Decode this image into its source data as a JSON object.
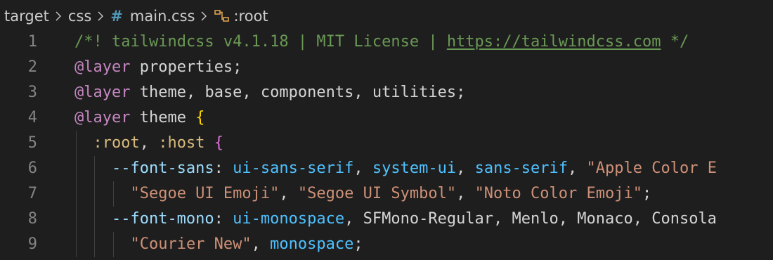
{
  "breadcrumb": {
    "items": [
      "target",
      "css",
      "main.css",
      ":root"
    ],
    "file_icon": "hash-icon",
    "symbol_icon": "symbol-icon"
  },
  "colors": {
    "background": "#1e1e1e",
    "line_number": "#858585",
    "comment": "#6a9955",
    "at_rule": "#c586c0",
    "selector": "#d7ba7d",
    "property": "#9cdcfe",
    "keyword": "#4fc1ff",
    "string": "#ce9178",
    "brace_level1": "#ffd700",
    "brace_level2": "#da70d6"
  },
  "code": {
    "lines": [
      {
        "number": "1",
        "tokens": [
          {
            "text": "/*! tailwindcss v4.1.18 | MIT License | ",
            "type": "comment"
          },
          {
            "text": "https://tailwindcss.com",
            "type": "link"
          },
          {
            "text": " */",
            "type": "comment"
          }
        ]
      },
      {
        "number": "2",
        "tokens": [
          {
            "text": "@layer",
            "type": "atrule"
          },
          {
            "text": " properties;",
            "type": "plain"
          }
        ]
      },
      {
        "number": "3",
        "tokens": [
          {
            "text": "@layer",
            "type": "atrule"
          },
          {
            "text": " theme, base, components, utilities;",
            "type": "plain"
          }
        ]
      },
      {
        "number": "4",
        "tokens": [
          {
            "text": "@layer",
            "type": "atrule"
          },
          {
            "text": " theme ",
            "type": "plain"
          },
          {
            "text": "{",
            "type": "brace-y"
          }
        ]
      },
      {
        "number": "5",
        "tokens": [
          {
            "text": ":root",
            "type": "selector"
          },
          {
            "text": ", ",
            "type": "plain"
          },
          {
            "text": ":host",
            "type": "selector"
          },
          {
            "text": " ",
            "type": "plain"
          },
          {
            "text": "{",
            "type": "brace-p"
          }
        ]
      },
      {
        "number": "6",
        "tokens": [
          {
            "text": "--font-sans",
            "type": "prop"
          },
          {
            "text": ": ",
            "type": "plain"
          },
          {
            "text": "ui-sans-serif",
            "type": "kw"
          },
          {
            "text": ", ",
            "type": "plain"
          },
          {
            "text": "system-ui",
            "type": "kw"
          },
          {
            "text": ", ",
            "type": "plain"
          },
          {
            "text": "sans-serif",
            "type": "kw"
          },
          {
            "text": ", ",
            "type": "plain"
          },
          {
            "text": "\"Apple Color E",
            "type": "string"
          }
        ]
      },
      {
        "number": "7",
        "tokens": [
          {
            "text": "\"Segoe UI Emoji\"",
            "type": "string"
          },
          {
            "text": ", ",
            "type": "plain"
          },
          {
            "text": "\"Segoe UI Symbol\"",
            "type": "string"
          },
          {
            "text": ", ",
            "type": "plain"
          },
          {
            "text": "\"Noto Color Emoji\"",
            "type": "string"
          },
          {
            "text": ";",
            "type": "plain"
          }
        ]
      },
      {
        "number": "8",
        "tokens": [
          {
            "text": "--font-mono",
            "type": "prop"
          },
          {
            "text": ": ",
            "type": "plain"
          },
          {
            "text": "ui-monospace",
            "type": "kw"
          },
          {
            "text": ", SFMono-Regular, Menlo, Monaco, Consola",
            "type": "plain"
          }
        ]
      },
      {
        "number": "9",
        "tokens": [
          {
            "text": "\"Courier New\"",
            "type": "string"
          },
          {
            "text": ", ",
            "type": "plain"
          },
          {
            "text": "monospace",
            "type": "kw"
          },
          {
            "text": ";",
            "type": "plain"
          }
        ]
      }
    ]
  }
}
